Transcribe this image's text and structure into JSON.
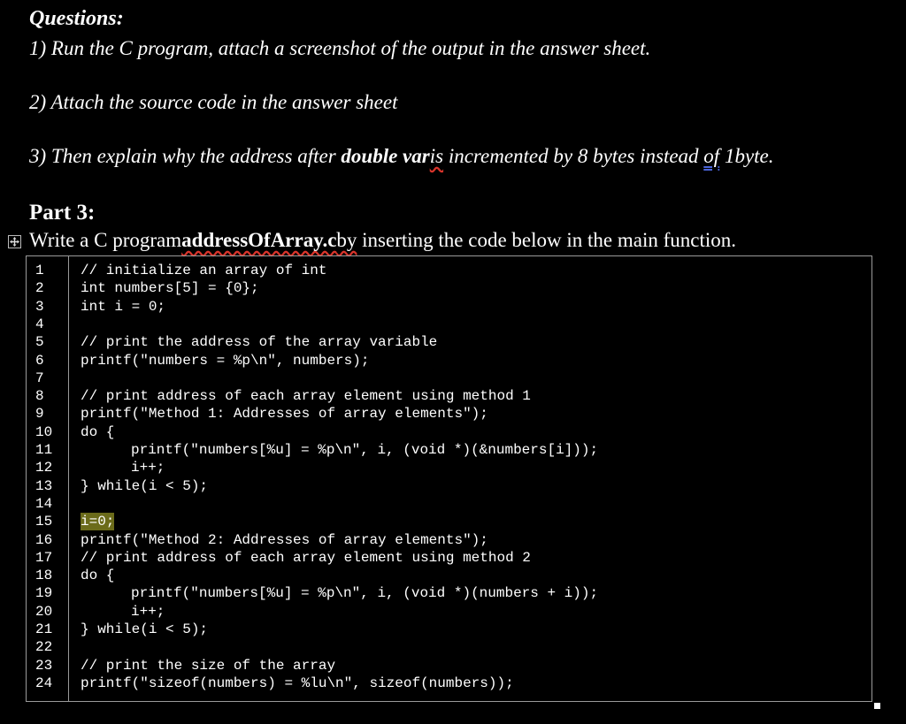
{
  "questions": {
    "heading": "Questions:",
    "q1": "1) Run the C program, attach a screenshot of the output in the answer sheet.",
    "q2": "2) Attach the source code in the answer sheet",
    "q3_pre": "3) Then explain why the address after ",
    "q3_bold": "double var",
    "q3_is": "is",
    "q3_mid": " incremented by 8 bytes instead ",
    "q3_of": "of",
    "q3_end": " 1byte."
  },
  "part": {
    "heading": "Part 3:",
    "write_pre": "Write a C program",
    "write_file": "addressOfArray.c",
    "write_by": "by",
    "write_post": " inserting the code below in the main function."
  },
  "code": {
    "lines": [
      {
        "n": "1",
        "text": "// initialize an array of int"
      },
      {
        "n": "2",
        "text": "int numbers[5] = {0};"
      },
      {
        "n": "3",
        "text": "int i = 0;"
      },
      {
        "n": "4",
        "text": ""
      },
      {
        "n": "5",
        "text": "// print the address of the array variable"
      },
      {
        "n": "6",
        "text": "printf(\"numbers = %p\\n\", numbers);"
      },
      {
        "n": "7",
        "text": ""
      },
      {
        "n": "8",
        "text": "// print address of each array element using method 1"
      },
      {
        "n": "9",
        "text": "printf(\"Method 1: Addresses of array elements\");"
      },
      {
        "n": "10",
        "text": "do {"
      },
      {
        "n": "11",
        "text": "printf(\"numbers[%u] = %p\\n\", i, (void *)(&numbers[i]));",
        "indent": true
      },
      {
        "n": "12",
        "text": "i++;",
        "indent": true
      },
      {
        "n": "13",
        "text": "} while(i < 5);"
      },
      {
        "n": "14",
        "text": ""
      },
      {
        "n": "15",
        "text": "i=0;",
        "highlight": true
      },
      {
        "n": "16",
        "text": "printf(\"Method 2: Addresses of array elements\");"
      },
      {
        "n": "17",
        "text": "// print address of each array element using method 2"
      },
      {
        "n": "18",
        "text": "do {"
      },
      {
        "n": "19",
        "text": "printf(\"numbers[%u] = %p\\n\", i, (void *)(numbers + i));",
        "indent": true
      },
      {
        "n": "20",
        "text": "i++;",
        "indent": true
      },
      {
        "n": "21",
        "text": "} while(i < 5);"
      },
      {
        "n": "22",
        "text": ""
      },
      {
        "n": "23",
        "text": "// print the size of the array"
      },
      {
        "n": "24",
        "text": "printf(\"sizeof(numbers) = %lu\\n\", sizeof(numbers));"
      }
    ]
  }
}
